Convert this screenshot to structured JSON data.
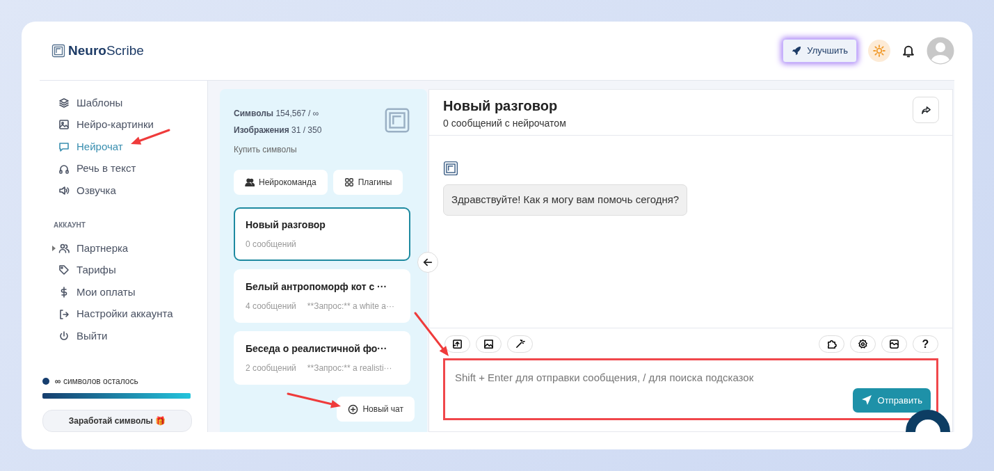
{
  "brand": {
    "bold": "Neuro",
    "light": "Scribe"
  },
  "header": {
    "upgrade": "Улучшить"
  },
  "sidebar": {
    "items": [
      {
        "label": "Шаблоны",
        "selected": false
      },
      {
        "label": "Нейро-картинки",
        "selected": false
      },
      {
        "label": "Нейрочат",
        "selected": true
      },
      {
        "label": "Речь в текст",
        "selected": false
      },
      {
        "label": "Озвучка",
        "selected": false
      }
    ],
    "section": "АККАУНТ",
    "account_items": [
      {
        "label": "Партнерка",
        "expandable": true
      },
      {
        "label": "Тарифы",
        "expandable": false
      },
      {
        "label": "Мои оплаты",
        "expandable": false
      },
      {
        "label": "Настройки аккаунта",
        "expandable": false
      },
      {
        "label": "Выйти",
        "expandable": false
      }
    ],
    "credits": {
      "text": "**∞** символов осталось",
      "level": 1
    },
    "earn": "Заработай символы 🎁"
  },
  "chat_list": {
    "stats": [
      "**Символы** 154,567 / ∞",
      "**Изображения** 31 / 350"
    ],
    "buy": "Купить символы",
    "buttons": [
      {
        "label": "Нейрокоманда"
      },
      {
        "label": "Плагины"
      }
    ],
    "chats": [
      {
        "title": "Новый разговор",
        "count": "0 сообщений",
        "selected": true
      },
      {
        "title": "Белый антропоморф кот с ···",
        "count": "4 сообщений",
        "preview": "**Запрос:** a white a···",
        "selected": false
      },
      {
        "title": "Беседа о реалистичной фо···",
        "count": "2 сообщений",
        "preview": "**Запрос:** a realisti···",
        "selected": false
      }
    ],
    "new_chat": "Новый чат"
  },
  "chat": {
    "title": "Новый разговор",
    "subtitle": "0 сообщений с нейрочатом",
    "messages": [
      {
        "text": "Здравствуйте! Как я могу вам помочь сегодня?"
      }
    ],
    "placeholder": "Shift + Enter для отправки сообщения, / для поиска подсказок",
    "send": "Отправить",
    "help": "?"
  }
}
